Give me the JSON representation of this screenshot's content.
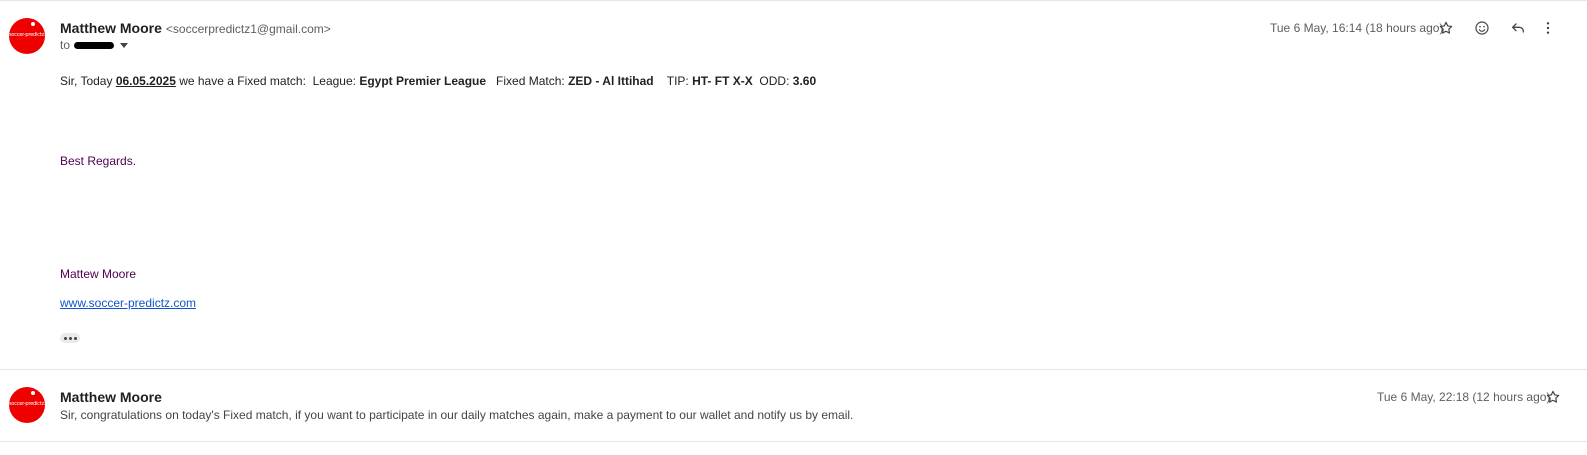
{
  "message1": {
    "avatar_text": "soccer-predictz.com",
    "sender_name": "Matthew Moore",
    "sender_email": "<soccerpredictz1@gmail.com>",
    "to_label": "to",
    "timestamp": "Tue 6 May, 16:14 (18 hours ago)",
    "body": {
      "intro": "Sir, Today ",
      "date": "06.05.2025",
      "part2": " we have a Fixed match:  League: ",
      "league": "Egypt Premier League",
      "part3": "   Fixed Match: ",
      "match": "ZED - Al Ittihad",
      "part4": "    TIP: ",
      "tip": "HT- FT X-X",
      "part5": "  ODD: ",
      "odd": "3.60",
      "regards": "Best Regards.",
      "signature_name": "Mattew Moore",
      "website": "www.soccer-predictz.com"
    },
    "icons": [
      "star-icon",
      "emoji-icon",
      "reply-icon",
      "more-vert-icon"
    ]
  },
  "message2": {
    "avatar_text": "soccer-predictz.com",
    "sender_name": "Matthew Moore",
    "timestamp": "Tue 6 May, 22:18 (12 hours ago)",
    "snippet": "Sir, congratulations on today's Fixed match, if you want to participate in our daily matches again, make a payment to our wallet and notify us by email.",
    "icons": [
      "star-icon"
    ]
  },
  "colors": {
    "avatar_bg": "#ee0000",
    "purple_text": "#500050",
    "link": "#1155cc"
  }
}
